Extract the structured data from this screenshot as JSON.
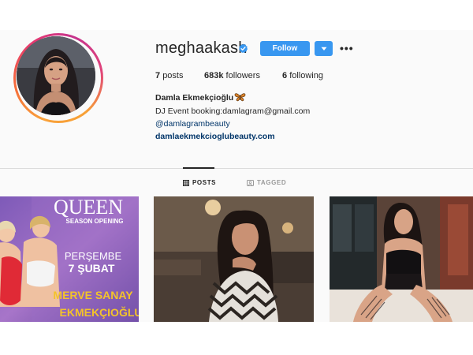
{
  "profile": {
    "username": "meghaakash",
    "verified": true,
    "follow_label": "Follow",
    "more_label": "•••"
  },
  "stats": {
    "posts_count": "7",
    "posts_label": "posts",
    "followers_count": "683k",
    "followers_label": "followers",
    "following_count": "6",
    "following_label": "following"
  },
  "bio": {
    "full_name": "Damla Ekmekçioğlu",
    "line1": "DJ Event booking:damlagram@gmail.com",
    "mention": "@damlagrambeauty",
    "website": "damlaekmekcioglubeauty.com"
  },
  "tabs": [
    {
      "label": "POSTS",
      "icon": "grid-icon",
      "active": true
    },
    {
      "label": "TAGGED",
      "icon": "tag-icon",
      "active": false
    }
  ],
  "posts": [
    {
      "poster_title": "QUEEN",
      "poster_subtitle": "SEASON OPENING",
      "poster_day": "PERŞEMBE",
      "poster_date": "7 ŞUBAT",
      "poster_name1": "MERVE SANAY",
      "poster_name2": "EKMEKÇIOĞLU"
    },
    {},
    {}
  ],
  "colors": {
    "accent": "#3897f0",
    "link": "#003569",
    "text": "#262626",
    "muted": "#999999"
  }
}
